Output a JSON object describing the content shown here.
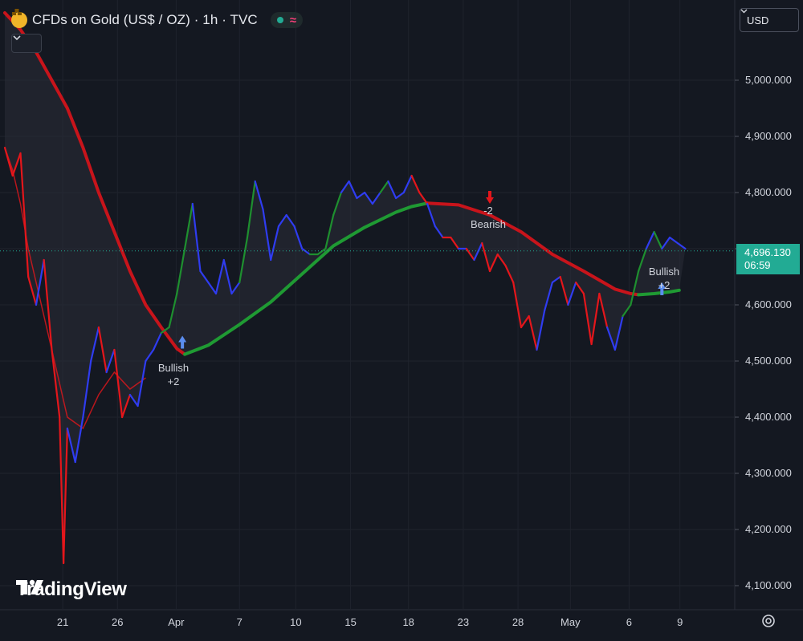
{
  "header": {
    "title": "CFDs on Gold (US$ / OZ) · 1h · TVC",
    "symbol_icon": "gold-bars-icon",
    "status_icon": "market-open-dot-icon",
    "status_color": "#22ab94",
    "indicator_icon": "wave-icon",
    "indicator_color": "#f23f78",
    "collapse_icon": "chevron-down-icon"
  },
  "currency": {
    "label": "USD",
    "icon": "chevron-down-icon"
  },
  "price_scale": {
    "ticks": [
      "5,000.000",
      "4,900.000",
      "4,800.000",
      "4,700.000",
      "4,600.000",
      "4,500.000",
      "4,400.000",
      "4,300.000",
      "4,200.000",
      "4,100.000"
    ],
    "tick_values": [
      5000,
      4900,
      4800,
      4700,
      4600,
      4500,
      4400,
      4300,
      4200,
      4100
    ]
  },
  "last_price": {
    "value": "4,696.130",
    "countdown": "06:59",
    "color": "#22ab94",
    "price": 4696.13
  },
  "time_scale": {
    "ticks": [
      "21",
      "26",
      "Apr",
      "7",
      "10",
      "15",
      "18",
      "23",
      "28",
      "May",
      "6",
      "9"
    ],
    "tick_hours": [
      74,
      144,
      219,
      300,
      372,
      442,
      516,
      586,
      656,
      723,
      798,
      863
    ]
  },
  "signals": [
    {
      "line1": "Bullish",
      "line2": "+2",
      "direction": "up",
      "hour": 227,
      "price": 4545
    },
    {
      "line1": "-2",
      "line2": "Bearish",
      "direction": "down",
      "hour": 620,
      "price": 4780
    },
    {
      "line1": "Bullish",
      "line2": "+2",
      "direction": "up",
      "hour": 840,
      "price": 4640
    }
  ],
  "logo": {
    "text": "TradingView",
    "icon": "tradingview-logo-icon"
  },
  "settings_icon": "settings-gear-icon",
  "chart_data": {
    "type": "line",
    "title": "CFDs on Gold (US$ / OZ) · 1h · TVC",
    "xlabel": "",
    "ylabel": "",
    "ylim": [
      4060,
      5140
    ],
    "xlim": [
      0,
      930
    ],
    "x_unit": "hours (1h bars)",
    "grid": true,
    "series": [
      {
        "role": "price",
        "color_map": {
          "bullish": "#1e8f2f",
          "neutral": "#2f3cf0",
          "bearish": "#e4161b"
        },
        "x": [
          0,
          10,
          20,
          30,
          40,
          50,
          60,
          70,
          75,
          80,
          90,
          100,
          110,
          120,
          130,
          140,
          150,
          160,
          170,
          180,
          190,
          200,
          210,
          220,
          230,
          240,
          250,
          260,
          270,
          280,
          290,
          300,
          310,
          320,
          330,
          340,
          350,
          360,
          370,
          380,
          390,
          400,
          410,
          420,
          430,
          440,
          450,
          460,
          470,
          480,
          490,
          500,
          510,
          520,
          530,
          540,
          550,
          560,
          570,
          580,
          590,
          600,
          610,
          620,
          630,
          640,
          650,
          660,
          670,
          680,
          690,
          700,
          710,
          720,
          730,
          740,
          750,
          760,
          770,
          780,
          790,
          800,
          810,
          820,
          830,
          840,
          850,
          860,
          870
        ],
        "y": [
          4880,
          4830,
          4870,
          4650,
          4600,
          4680,
          4520,
          4400,
          4140,
          4380,
          4320,
          4400,
          4500,
          4560,
          4480,
          4520,
          4400,
          4440,
          4420,
          4500,
          4520,
          4550,
          4560,
          4620,
          4700,
          4780,
          4660,
          4640,
          4620,
          4680,
          4620,
          4640,
          4720,
          4820,
          4770,
          4680,
          4740,
          4760,
          4740,
          4700,
          4690,
          4690,
          4700,
          4760,
          4800,
          4820,
          4790,
          4800,
          4780,
          4800,
          4820,
          4790,
          4800,
          4830,
          4800,
          4780,
          4740,
          4720,
          4720,
          4700,
          4700,
          4680,
          4710,
          4660,
          4690,
          4670,
          4640,
          4560,
          4580,
          4520,
          4590,
          4640,
          4650,
          4600,
          4640,
          4620,
          4530,
          4620,
          4560,
          4520,
          4580,
          4600,
          4660,
          4700,
          4730,
          4700,
          4720,
          4710,
          4700
        ],
        "state": [
          "bearish",
          "bearish",
          "bearish",
          "bearish",
          "bearish",
          "neutral",
          "bearish",
          "bearish",
          "bearish",
          "bearish",
          "neutral",
          "neutral",
          "neutral",
          "neutral",
          "bearish",
          "neutral",
          "bearish",
          "bearish",
          "neutral",
          "neutral",
          "neutral",
          "neutral",
          "bullish",
          "bullish",
          "bullish",
          "bullish",
          "neutral",
          "neutral",
          "neutral",
          "neutral",
          "neutral",
          "neutral",
          "bullish",
          "bullish",
          "neutral",
          "neutral",
          "neutral",
          "neutral",
          "neutral",
          "neutral",
          "neutral",
          "bullish",
          "bullish",
          "bullish",
          "bullish",
          "neutral",
          "neutral",
          "neutral",
          "neutral",
          "neutral",
          "bullish",
          "neutral",
          "neutral",
          "neutral",
          "bearish",
          "bearish",
          "neutral",
          "neutral",
          "bearish",
          "bearish",
          "neutral",
          "bearish",
          "neutral",
          "bearish",
          "bearish",
          "bearish",
          "bearish",
          "bearish",
          "bearish",
          "bearish",
          "neutral",
          "neutral",
          "neutral",
          "bearish",
          "neutral",
          "bearish",
          "bearish",
          "bearish",
          "bearish",
          "neutral",
          "neutral",
          "bullish",
          "bullish",
          "bullish",
          "neutral",
          "bullish",
          "neutral",
          "neutral",
          "neutral"
        ]
      },
      {
        "role": "fast-ma",
        "color": "#e4161b",
        "x": [
          0,
          10,
          20,
          30,
          40,
          60,
          80,
          100,
          120,
          140,
          160,
          180
        ],
        "y": [
          4880,
          4840,
          4780,
          4700,
          4640,
          4520,
          4400,
          4380,
          4440,
          4480,
          4450,
          4470
        ]
      },
      {
        "role": "slow-ma-bearish",
        "color": "#c8141b",
        "x": [
          0,
          20,
          40,
          60,
          80,
          100,
          120,
          140,
          160,
          180,
          200,
          220,
          230
        ],
        "y": [
          5120,
          5090,
          5050,
          5000,
          4950,
          4880,
          4800,
          4730,
          4660,
          4600,
          4560,
          4522,
          4512
        ]
      },
      {
        "role": "slow-ma-bullish",
        "color": "#1f9a33",
        "x": [
          230,
          260,
          300,
          340,
          380,
          420,
          460,
          500,
          520,
          540
        ],
        "y": [
          4512,
          4528,
          4565,
          4605,
          4655,
          4705,
          4738,
          4765,
          4775,
          4781
        ]
      },
      {
        "role": "slow-ma-bearish-2",
        "color": "#c8141b",
        "x": [
          540,
          580,
          620,
          660,
          700,
          740,
          780,
          800,
          810
        ],
        "y": [
          4781,
          4778,
          4760,
          4730,
          4690,
          4660,
          4628,
          4620,
          4618
        ]
      },
      {
        "role": "slow-ma-bullish-2",
        "color": "#1f9a33",
        "x": [
          810,
          830,
          850,
          862
        ],
        "y": [
          4618,
          4620,
          4623,
          4626
        ]
      }
    ]
  }
}
